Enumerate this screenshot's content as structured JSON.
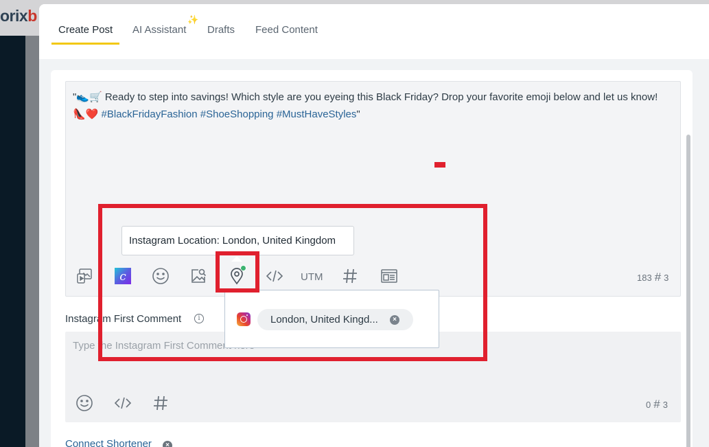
{
  "app": {
    "logo_text_a": "orix",
    "logo_text_b": "b"
  },
  "tabs": [
    {
      "label": "Create Post",
      "active": true
    },
    {
      "label": "AI Assistant",
      "active": false
    },
    {
      "label": "Drafts",
      "active": false
    },
    {
      "label": "Feed Content",
      "active": false
    }
  ],
  "editor": {
    "post_text": "\"👟🛒 Ready to step into savings! Which style are you eyeing this Black Friday? Drop your favorite emoji below and let us know! 👠❤️ ",
    "post_hashtags": "#BlackFridayFashion #ShoeShopping #MustHaveStyles",
    "post_text_end": "\"",
    "toolbar": {
      "utm_label": "UTM",
      "char_count": "183",
      "hashtag_count": "3"
    }
  },
  "tooltip": {
    "text": "Instagram Location: London, United Kingdom"
  },
  "location_dropdown": {
    "chip_label": "London, United Kingd...",
    "chip_close": "×"
  },
  "first_comment": {
    "label": "Instagram First Comment",
    "placeholder": "Type the Instagram First Comment here",
    "char_count": "0",
    "hashtag_count": "3"
  },
  "connect_shortener": {
    "label": "Connect Shortener",
    "close": "×"
  },
  "icons": {
    "media": "media-library-icon",
    "canva": "canva-icon",
    "emoji": "emoji-icon",
    "image_search": "image-search-icon",
    "location": "location-pin-icon",
    "code": "code-icon",
    "hashtag": "hashtag-icon",
    "template": "template-icon",
    "instagram": "instagram-icon",
    "info": "info-icon"
  },
  "colors": {
    "tab_underline": "#f2c811",
    "link": "#2a6496",
    "annotation": "#e0202e",
    "status_dot": "#3cb371"
  }
}
